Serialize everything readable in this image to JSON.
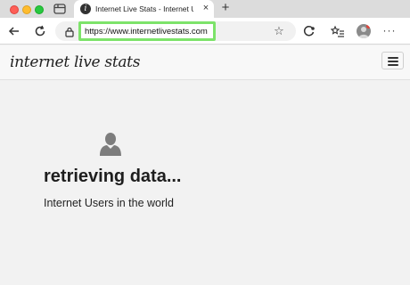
{
  "browser": {
    "tab": {
      "title": "Internet Live Stats - Internet Us",
      "favicon_letter": "i",
      "close_glyph": "×"
    },
    "new_tab_glyph": "+",
    "address_bar": {
      "url": "https://www.internetlivestats.com",
      "highlight_color": "#7de36a"
    },
    "icons": [
      "tab-grid-icon",
      "back-arrow-icon",
      "reload-icon",
      "lock-icon",
      "star-icon",
      "extension-icon",
      "collections-icon",
      "profile-avatar",
      "more-icon"
    ]
  },
  "site": {
    "logo": "internet live stats",
    "status": "retrieving data...",
    "label": "Internet Users in the world"
  },
  "colors": {
    "traffic_red": "#fe5f57",
    "traffic_yellow": "#febc2e",
    "traffic_green": "#28c840",
    "page_bg": "#f2f2f2"
  }
}
